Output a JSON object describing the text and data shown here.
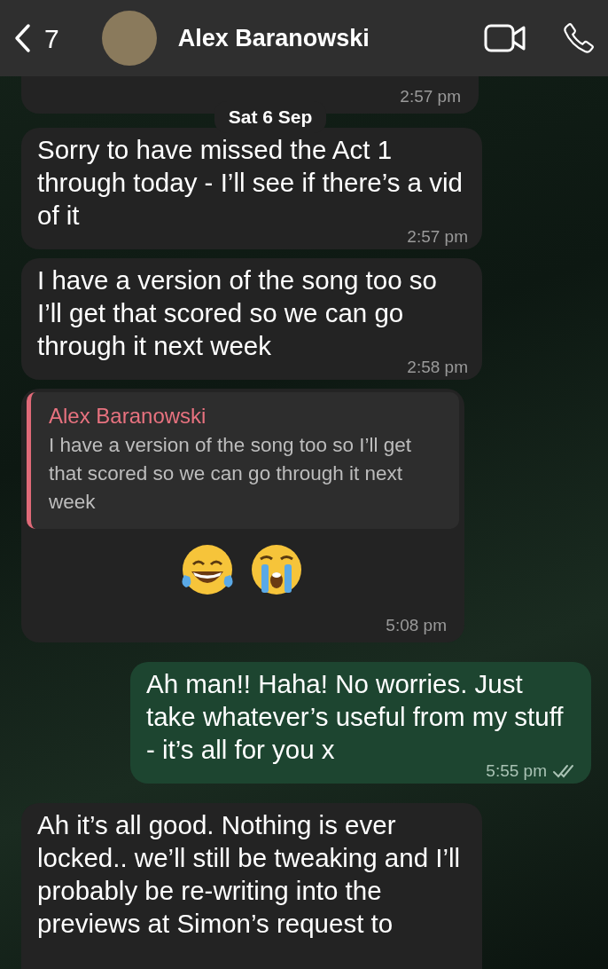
{
  "header": {
    "back_count": "7",
    "contact_name": "Alex Baranowski"
  },
  "date_chip": "Sat 6 Sep",
  "messages": [
    {
      "kind": "stub",
      "time": "2:57 pm"
    },
    {
      "kind": "incoming",
      "text": "Sorry to have missed the Act 1 through today - I’ll see if there’s a vid of it",
      "time": "2:57 pm"
    },
    {
      "kind": "incoming",
      "text": "I have a version of the song too so I’ll get that scored so we can go through it next week",
      "time": "2:58 pm"
    },
    {
      "kind": "reply",
      "quote": {
        "author": "Alex Baranowski",
        "text": "I have a version of the song too so I’ll get that scored so we can go through it next week"
      },
      "time": "5:08 pm"
    },
    {
      "kind": "outgoing",
      "text": "Ah man!! Haha! No worries. Just take whatever’s useful from my stuff - it’s all for you x",
      "time": "5:55 pm",
      "delivered": true
    },
    {
      "kind": "incoming",
      "text": "Ah it’s all good. Nothing is ever locked.. we’ll still be tweaking and I’ll probably be re-writing into the previews at Simon’s request to"
    }
  ]
}
